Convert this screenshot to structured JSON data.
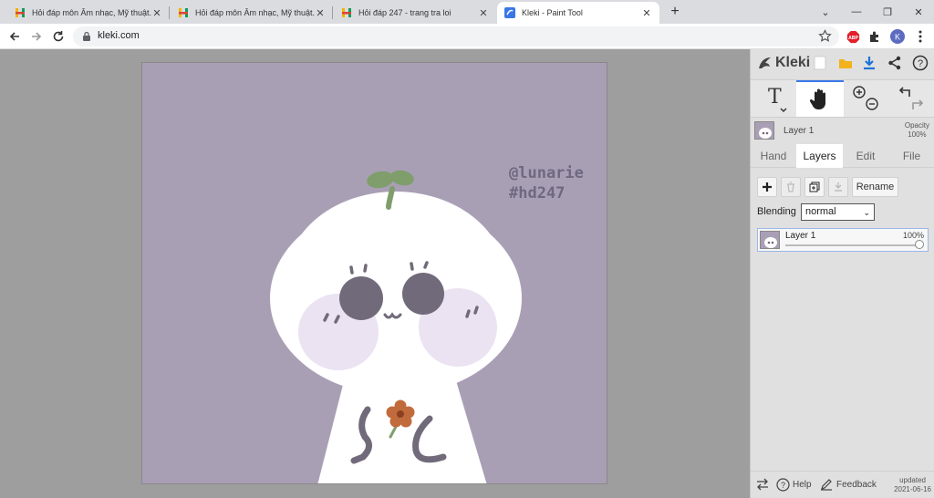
{
  "browser": {
    "tabs": [
      {
        "title": "Hỏi đáp môn Âm nhạc, Mỹ thuật...",
        "icon": "hoidap-favicon-icon"
      },
      {
        "title": "Hỏi đáp môn Âm nhạc, Mỹ thuật...",
        "icon": "hoidap-favicon-icon"
      },
      {
        "title": "Hỏi đáp 247 - trang tra loi",
        "icon": "hoidap-favicon-icon"
      },
      {
        "title": "Kleki - Paint Tool",
        "icon": "kleki-favicon-icon"
      }
    ],
    "url": "kleki.com",
    "profile_initial": "K",
    "adblock_label": "ABP"
  },
  "canvas": {
    "watermark_line1": "@lunarie",
    "watermark_line2": "#hd247",
    "background": "#a99fb5"
  },
  "panel": {
    "brand": "Kleki",
    "layer_header": {
      "name": "Layer 1",
      "opacity_label": "Opacity",
      "opacity_value": "100%"
    },
    "tabs": [
      "Hand",
      "Layers",
      "Edit",
      "File"
    ],
    "active_tab": "Layers",
    "rename_label": "Rename",
    "blending_label": "Blending",
    "blending_value": "normal",
    "layers": [
      {
        "name": "Layer 1",
        "opacity": "100%"
      }
    ],
    "bottom": {
      "help": "Help",
      "feedback": "Feedback",
      "updated_label": "updated",
      "updated_date": "2021-06-16"
    }
  },
  "colors": {
    "accent": "#3a78e8",
    "canvas_bg": "#a99fb5",
    "panel_bg": "#e0e0e0",
    "workspace": "#9e9e9e"
  }
}
